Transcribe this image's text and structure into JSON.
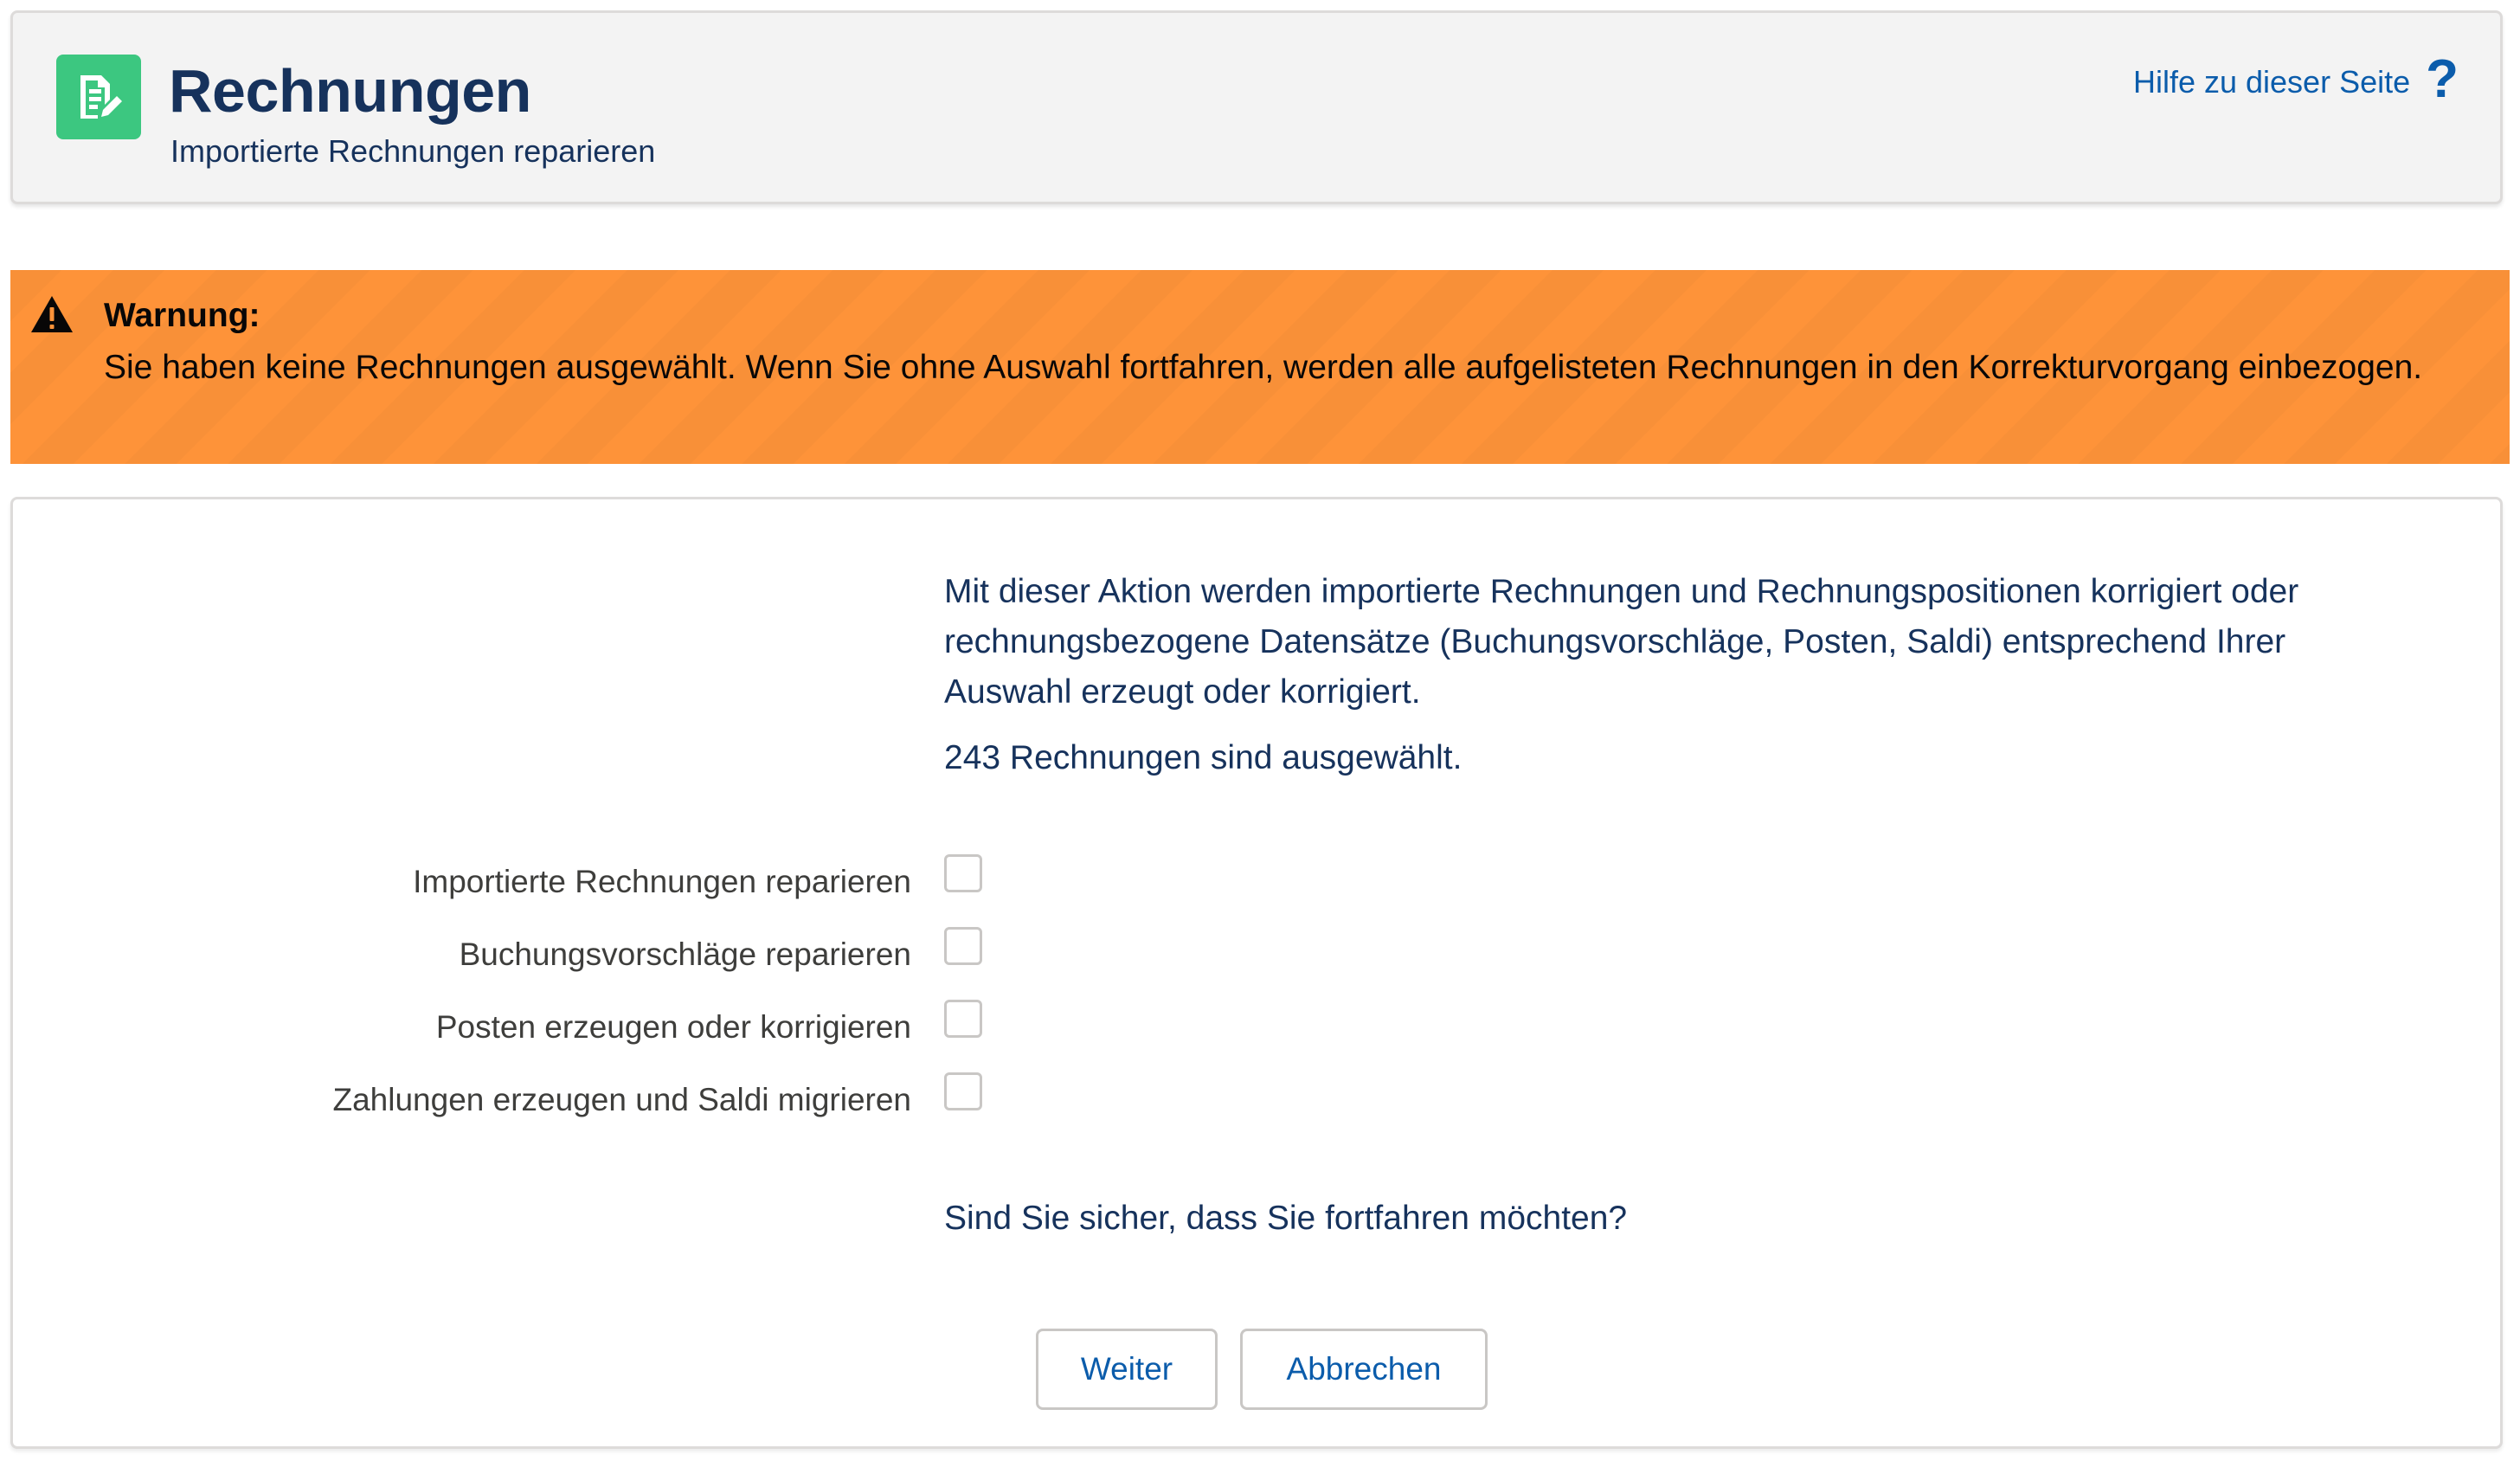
{
  "header": {
    "title": "Rechnungen",
    "subtitle": "Importierte Rechnungen reparieren",
    "help_label": "Hilfe zu dieser Seite",
    "help_symbol": "?",
    "app_icon": "document-edit-icon",
    "accent_color": "#3cc780"
  },
  "warning": {
    "icon": "warning-triangle-icon",
    "title": "Warnung:",
    "text": "Sie haben keine Rechnungen ausgewählt. Wenn Sie ohne Auswahl fortfahren, werden alle aufgelisteten Rechnungen in den Korrekturvorgang einbezogen.",
    "color": "#fe9339"
  },
  "main": {
    "description": "Mit dieser Aktion werden importierte Rechnungen und Rechnungspositionen korrigiert oder rechnungsbezogene Datensätze (Buchungsvorschläge, Posten, Saldi) entsprechend Ihrer Auswahl erzeugt oder korrigiert.",
    "selection_count": "243 Rechnungen sind ausgewählt.",
    "options": [
      {
        "label": "Importierte Rechnungen reparieren",
        "checked": false
      },
      {
        "label": "Buchungsvorschläge reparieren",
        "checked": false
      },
      {
        "label": "Posten erzeugen oder korrigieren",
        "checked": false
      },
      {
        "label": "Zahlungen erzeugen und Saldi migrieren",
        "checked": false
      }
    ],
    "confirm_question": "Sind Sie sicher, dass Sie fortfahren möchten?",
    "buttons": {
      "next_label": "Weiter",
      "cancel_label": "Abbrechen"
    }
  }
}
